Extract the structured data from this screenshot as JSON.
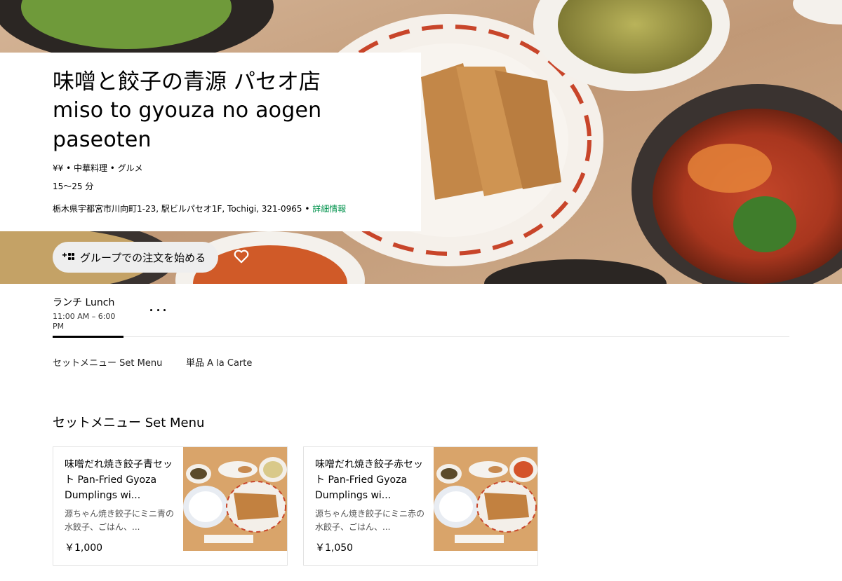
{
  "store": {
    "title_ja": "味噌と餃子の青源 パセオ店",
    "title_en": "miso to gyouza no aogen paseoten",
    "price_category": "¥¥ • 中華料理 • グルメ",
    "eta": "15～25 分",
    "address": "栃木県宇都宮市川向町1-23, 駅ビルパセオ1F, Tochigi, 321-0965 • ",
    "detail_link": "詳細情報"
  },
  "actions": {
    "group_order_label": "グループでの注文を始める",
    "favorite_icon": "heart-icon",
    "group_icon": "group-add-icon"
  },
  "menu": {
    "active_tab": {
      "title_ja": "ランチ",
      "title_en": "Lunch",
      "hours": "11:00 AM – 6:00 PM"
    },
    "categories": [
      {
        "label": "セットメニュー Set Menu"
      },
      {
        "label": "単品 A la Carte"
      }
    ]
  },
  "section": {
    "title": "セットメニュー Set Menu",
    "items": [
      {
        "name": "味噌だれ焼き餃子青セット Pan-Fried Gyoza Dumplings wi...",
        "description": "源ちゃん焼き餃子にミニ青の水餃子、ごはん、...",
        "price": "￥1,000",
        "soup_color": "#d9c98a"
      },
      {
        "name": "味噌だれ焼き餃子赤セット Pan-Fried Gyoza Dumplings wi...",
        "description": "源ちゃん焼き餃子にミニ赤の水餃子、ごはん、...",
        "price": "￥1,050",
        "soup_color": "#d4532a"
      }
    ]
  },
  "colors": {
    "link_green": "#05944f",
    "button_gray": "#eeeeee",
    "border": "#e2e2e2"
  }
}
